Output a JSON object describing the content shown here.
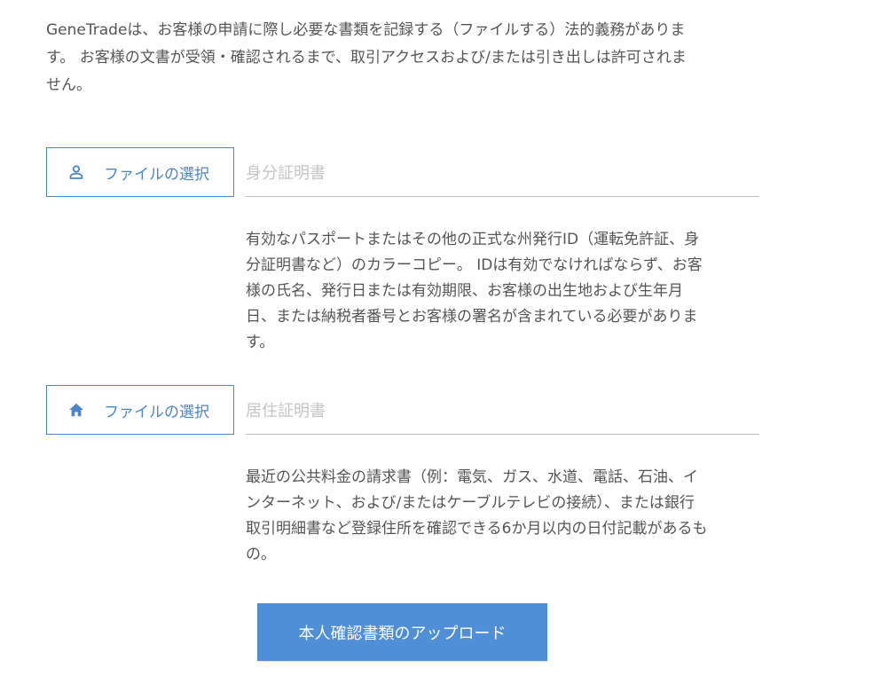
{
  "intro": {
    "line1": "GeneTradeは、お客様の申請に際し必要な書類を記録する（ファイルする）法的義務がありま",
    "line2": "す。 お客様の文書が受領・確認されるまで、取引アクセスおよび/または引き出しは許可されま",
    "line3": "せん。"
  },
  "identity": {
    "button_label": "ファイルの選択",
    "icon": "user-icon",
    "field_placeholder": "身分証明書",
    "desc_lines": [
      "有効なパスポートまたはその他の正式な州発行ID（運転免許証、身",
      "分証明書など）のカラーコピー。 IDは有効でなければならず、お客",
      "様の氏名、発行日または有効期限、お客様の出生地および生年月",
      "日、または納税者番号とお客様の署名が含まれている必要がありま",
      "す。"
    ]
  },
  "residence": {
    "button_label": "ファイルの選択",
    "icon": "home-icon",
    "field_placeholder": "居住証明書",
    "desc_lines": [
      "最近の公共料金の請求書（例：電気、ガス、水道、電話、石油、イ",
      "ンターネット、および/またはケーブルテレビの接続）、または銀行",
      "取引明細書など登録住所を確認できる6か月以内の日付記載があるも",
      "の。"
    ]
  },
  "upload_label": "本人確認書類のアップロード",
  "colors": {
    "accent": "#4a86c8",
    "button": "#4f8fd8",
    "text": "#555555",
    "placeholder": "#c4c4c4"
  }
}
